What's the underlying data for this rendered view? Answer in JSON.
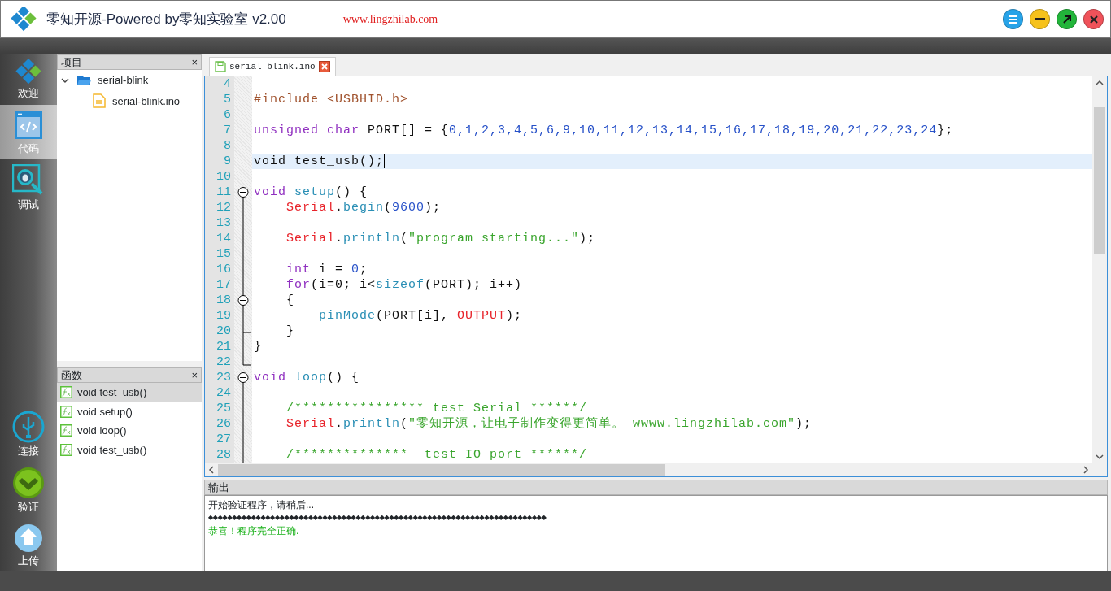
{
  "window": {
    "title": "零知开源-Powered by零知实验室 v2.00",
    "url": "www.lingzhilab.com",
    "controls": [
      {
        "kind": "menu"
      },
      {
        "kind": "minimize"
      },
      {
        "kind": "maximize"
      },
      {
        "kind": "close"
      }
    ]
  },
  "sidebar": {
    "items": [
      {
        "kind": "welcome",
        "label": "欢迎",
        "selected": false
      },
      {
        "kind": "code",
        "label": "代码",
        "selected": true
      },
      {
        "kind": "debug",
        "label": "调试",
        "selected": false
      }
    ],
    "actions": [
      {
        "kind": "connect",
        "label": "连接"
      },
      {
        "kind": "verify",
        "label": "验证"
      },
      {
        "kind": "upload",
        "label": "上传"
      }
    ]
  },
  "project_panel": {
    "title": "项目",
    "close": "×",
    "tree": [
      {
        "kind": "folder",
        "label": "serial-blink",
        "expanded": true,
        "children": [
          {
            "kind": "file",
            "label": "serial-blink.ino"
          }
        ]
      }
    ]
  },
  "functions_panel": {
    "title": "函数",
    "close": "×",
    "items": [
      {
        "label": "void test_usb()",
        "selected": true
      },
      {
        "label": "void setup()",
        "selected": false
      },
      {
        "label": "void loop()",
        "selected": false
      },
      {
        "label": "void test_usb()",
        "selected": false
      }
    ]
  },
  "editor": {
    "tabs": [
      {
        "label": "serial-blink.ino",
        "selected": true
      }
    ],
    "lines": [
      {
        "number": "4",
        "kind": "plain",
        "current": false
      },
      {
        "number": "5",
        "kind": "plain",
        "current": false,
        "tokens": [
          {
            "kind": "preprocessor",
            "text": "#include <USBHID.h>"
          }
        ]
      },
      {
        "number": "6",
        "kind": "plain",
        "current": false
      },
      {
        "number": "7",
        "kind": "plain",
        "current": false,
        "tokens": [
          {
            "kind": "keyword",
            "text": "unsigned char"
          },
          {
            "kind": "plain",
            "text": " PORT[] = {"
          },
          {
            "kind": "number",
            "text": "0,1,2,3,4,5,6,9,10,11,12,13,14,15,16,17,18,19,20,21,22,23,24"
          },
          {
            "kind": "plain",
            "text": "};"
          }
        ]
      },
      {
        "number": "8",
        "kind": "plain",
        "current": false
      },
      {
        "number": "9",
        "kind": "plain",
        "current": true,
        "tokens": [
          {
            "kind": "plain",
            "text": "void test_usb();"
          }
        ]
      },
      {
        "number": "10",
        "kind": "plain",
        "current": false
      },
      {
        "number": "11",
        "kind": "foldstart",
        "current": false,
        "tokens": [
          {
            "kind": "keyword",
            "text": "void"
          },
          {
            "kind": "function",
            "text": " setup"
          },
          {
            "kind": "plain",
            "text": "() {"
          }
        ]
      },
      {
        "number": "12",
        "kind": "foldline",
        "current": false,
        "tokens": [
          {
            "kind": "class",
            "text": "    Serial"
          },
          {
            "kind": "plain",
            "text": "."
          },
          {
            "kind": "function",
            "text": "begin"
          },
          {
            "kind": "plain",
            "text": "("
          },
          {
            "kind": "number",
            "text": "9600"
          },
          {
            "kind": "plain",
            "text": ");"
          }
        ]
      },
      {
        "number": "13",
        "kind": "foldline",
        "current": false
      },
      {
        "number": "14",
        "kind": "foldline",
        "current": false,
        "tokens": [
          {
            "kind": "class",
            "text": "    Serial"
          },
          {
            "kind": "plain",
            "text": "."
          },
          {
            "kind": "function",
            "text": "println"
          },
          {
            "kind": "plain",
            "text": "("
          },
          {
            "kind": "string",
            "text": "\"program starting...\""
          },
          {
            "kind": "plain",
            "text": ");"
          }
        ]
      },
      {
        "number": "15",
        "kind": "foldline",
        "current": false
      },
      {
        "number": "16",
        "kind": "foldline",
        "current": false,
        "tokens": [
          {
            "kind": "keyword",
            "text": "    int"
          },
          {
            "kind": "plain",
            "text": " i = "
          },
          {
            "kind": "number",
            "text": "0"
          },
          {
            "kind": "plain",
            "text": ";"
          }
        ]
      },
      {
        "number": "17",
        "kind": "foldline",
        "current": false,
        "tokens": [
          {
            "kind": "keyword",
            "text": "    for"
          },
          {
            "kind": "plain",
            "text": "(i=0; i<"
          },
          {
            "kind": "function",
            "text": "sizeof"
          },
          {
            "kind": "plain",
            "text": "(PORT); i++)"
          }
        ]
      },
      {
        "number": "18",
        "kind": "foldinnerstart",
        "current": false,
        "tokens": [
          {
            "kind": "plain",
            "text": "    {"
          }
        ]
      },
      {
        "number": "19",
        "kind": "foldline",
        "current": false,
        "tokens": [
          {
            "kind": "function",
            "text": "        pinMode"
          },
          {
            "kind": "plain",
            "text": "(PORT[i], "
          },
          {
            "kind": "class",
            "text": "OUTPUT"
          },
          {
            "kind": "plain",
            "text": ");"
          }
        ]
      },
      {
        "number": "20",
        "kind": "foldinnerend",
        "current": false,
        "tokens": [
          {
            "kind": "plain",
            "text": "    }"
          }
        ]
      },
      {
        "number": "21",
        "kind": "foldline",
        "current": false,
        "tokens": [
          {
            "kind": "plain",
            "text": "}"
          }
        ]
      },
      {
        "number": "22",
        "kind": "foldend",
        "current": false
      },
      {
        "number": "23",
        "kind": "foldstart",
        "current": false,
        "tokens": [
          {
            "kind": "keyword",
            "text": "void"
          },
          {
            "kind": "function",
            "text": " loop"
          },
          {
            "kind": "plain",
            "text": "() {"
          }
        ]
      },
      {
        "number": "24",
        "kind": "foldline",
        "current": false
      },
      {
        "number": "25",
        "kind": "foldline",
        "current": false,
        "tokens": [
          {
            "kind": "comment",
            "text": "    /**************** test Serial ******/"
          }
        ]
      },
      {
        "number": "26",
        "kind": "foldline",
        "current": false,
        "tokens": [
          {
            "kind": "class",
            "text": "    Serial"
          },
          {
            "kind": "plain",
            "text": "."
          },
          {
            "kind": "function",
            "text": "println"
          },
          {
            "kind": "plain",
            "text": "("
          },
          {
            "kind": "string",
            "text": "\"零知开源，让电子制作变得更简单。 wwww.lingzhilab.com\""
          },
          {
            "kind": "plain",
            "text": ");"
          }
        ]
      },
      {
        "number": "27",
        "kind": "foldline",
        "current": false
      },
      {
        "number": "28",
        "kind": "foldline",
        "current": false,
        "tokens": [
          {
            "kind": "comment",
            "text": "    /**************  test IO port ******/"
          }
        ]
      }
    ]
  },
  "output": {
    "title": "输出",
    "lines": [
      {
        "kind": "info",
        "text": "开始验证程序，请稍后..."
      },
      {
        "kind": "progress",
        "text": "◆◆◆◆◆◆◆◆◆◆◆◆◆◆◆◆◆◆◆◆◆◆◆◆◆◆◆◆◆◆◆◆◆◆◆◆◆◆◆◆◆◆◆◆◆◆◆◆◆◆◆◆◆◆◆◆◆◆◆◆◆◆◆◆◆◆◆◆◆◆◆"
      },
      {
        "kind": "success",
        "text": "恭喜！程序完全正确."
      }
    ]
  }
}
